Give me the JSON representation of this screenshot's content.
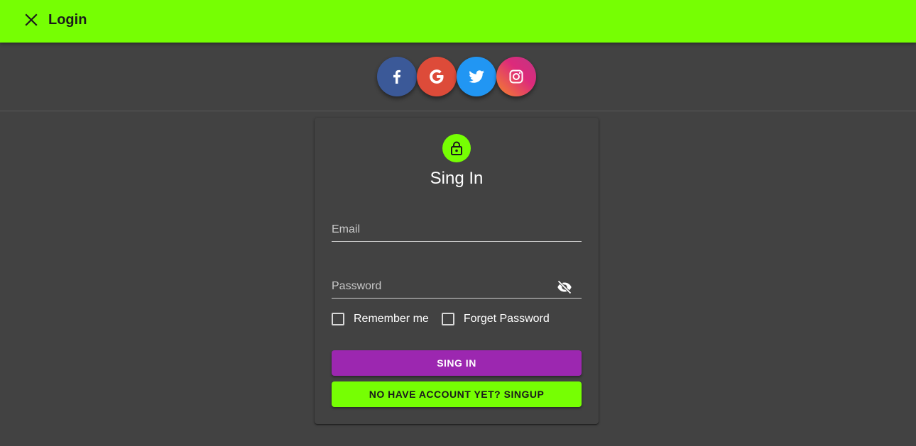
{
  "appbar": {
    "title": "Login",
    "close_icon": "close-icon",
    "color": "#76ff03"
  },
  "social": [
    {
      "name": "facebook",
      "icon": "facebook-icon",
      "color": "#3b5998"
    },
    {
      "name": "google",
      "icon": "google-icon",
      "color": "#dd4b39"
    },
    {
      "name": "twitter",
      "icon": "twitter-icon",
      "color": "#1da1f2"
    },
    {
      "name": "instagram",
      "icon": "instagram-icon",
      "color": "#e1306c"
    }
  ],
  "form": {
    "lock_icon": "lock-open-icon",
    "title": "Sing In",
    "email": {
      "placeholder": "Email",
      "value": ""
    },
    "password": {
      "placeholder": "Password",
      "value": "",
      "visibility_icon": "visibility-off-icon"
    },
    "remember_label": "Remember me",
    "forget_label": "Forget Password",
    "signin_label": "SING IN",
    "signup_label": "NO HAVE ACCOUNT YET? SINGUP",
    "primary_color": "#9c27b0",
    "accent_color": "#76ff03"
  }
}
